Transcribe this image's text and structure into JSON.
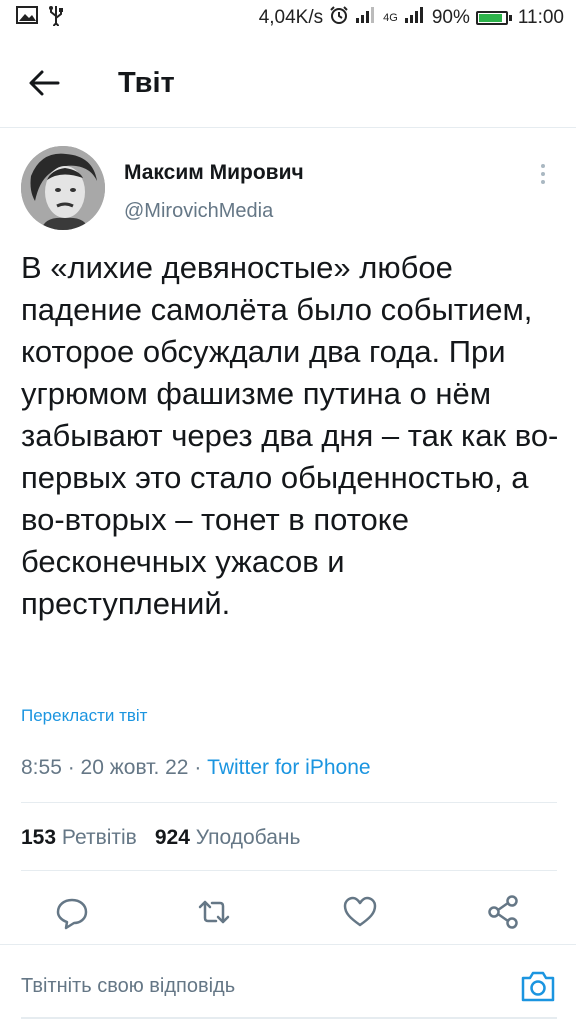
{
  "status_bar": {
    "network_speed": "4,04K/s",
    "network_type": "4G",
    "battery": "90%",
    "battery_level": 0.9,
    "time": "11:00",
    "icons": [
      "image-icon",
      "usb-icon",
      "alarm-icon",
      "signal-icon",
      "battery-icon"
    ]
  },
  "header": {
    "title": "Твіт",
    "back_icon": "arrow-left-icon"
  },
  "tweet": {
    "author_name": "Максим Мирович",
    "author_handle": "@MirovichMedia",
    "text": "В «лихие девяностые» любое падение самолёта было событием, которое обсуждали два года. При угрюмом фашизме путина о нём забывают через два дня – так как во-первых это стало обыденностью, а во-вторых – тонет в потоке бесконечных ужасов и преступлений.",
    "translate_label": "Перекласти твіт",
    "time": "8:55",
    "date": "20 жовт. 22",
    "separator": " · ",
    "source": "Twitter for iPhone",
    "retweets_count": "153",
    "retweets_label": "Ретвітів",
    "likes_count": "924",
    "likes_label": "Уподобань"
  },
  "actions": [
    {
      "name": "reply",
      "icon": "comment-icon"
    },
    {
      "name": "retweet",
      "icon": "retweet-icon"
    },
    {
      "name": "like",
      "icon": "heart-icon"
    },
    {
      "name": "share",
      "icon": "share-icon"
    }
  ],
  "reply_bar": {
    "placeholder": "Твітніть свою відповідь",
    "icon": "camera-icon"
  },
  "colors": {
    "accent": "#1b95e0",
    "text": "#14171a",
    "secondary": "#657786",
    "divider": "#e6ecf0",
    "battery": "#2db24a"
  }
}
